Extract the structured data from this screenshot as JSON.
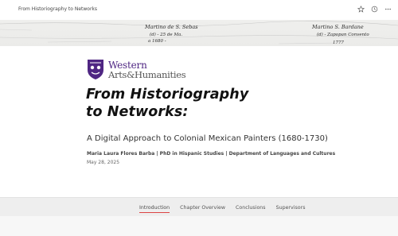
{
  "topbar": {
    "doc_title": "From Historiography to Networks",
    "icons": [
      "star-icon",
      "clock-icon",
      "more-icon"
    ]
  },
  "banner": {
    "handwriting_1": "Martino de S. Sebas",
    "handwriting_2": "Martino S. Bardane"
  },
  "logo": {
    "line1": "Western",
    "line2": "Arts&Humanities",
    "color": "#4f2683"
  },
  "hero": {
    "title_line1": "From Historiography",
    "title_line2": "to Networks:",
    "subtitle": "A Digital Approach to Colonial Mexican Painters (1680-1730)",
    "authors": "Maria Laura Flores Barba | PhD in Hispanic Studies | Department of Languages and Cultures",
    "date": "May 28, 2025"
  },
  "tabs": [
    {
      "label": "Introduction",
      "active": true
    },
    {
      "label": "Chapter Overview",
      "active": false
    },
    {
      "label": "Conclusions",
      "active": false
    },
    {
      "label": "Supervisors",
      "active": false
    }
  ],
  "colors": {
    "accent": "#d44444",
    "brand_purple": "#4f2683"
  }
}
